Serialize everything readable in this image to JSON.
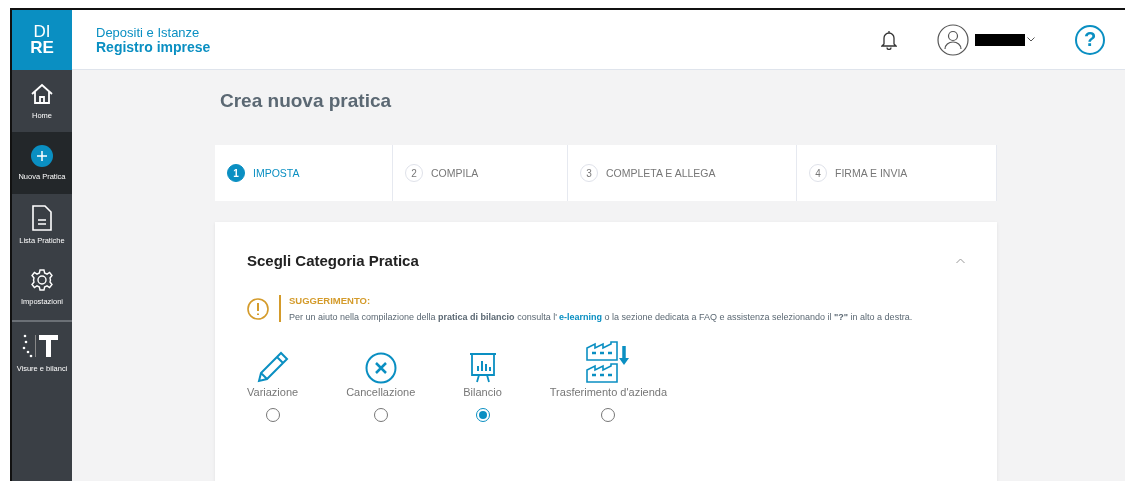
{
  "header": {
    "logo_top": "DI",
    "logo_bottom": "RE",
    "subtitle": "Depositi e Istanze",
    "title": "Registro imprese",
    "help": "?"
  },
  "sidebar": {
    "items": [
      {
        "label": "Home",
        "selected": false
      },
      {
        "label": "Nuova Pratica",
        "selected": true
      },
      {
        "label": "Lista Pratiche",
        "selected": false
      },
      {
        "label": "Impostazioni",
        "selected": false
      },
      {
        "label": "Visure e bilanci",
        "selected": false
      }
    ]
  },
  "page_title": "Crea nuova pratica",
  "steps": [
    {
      "number": "1",
      "label": "IMPOSTA",
      "selected": true
    },
    {
      "number": "2",
      "label": "COMPILA",
      "selected": false
    },
    {
      "number": "3",
      "label": "COMPLETA E ALLEGA",
      "selected": false
    },
    {
      "number": "4",
      "label": "FIRMA E INVIA",
      "selected": false
    }
  ],
  "card": {
    "title": "Scegli Categoria Pratica",
    "expanded": true,
    "hint": {
      "title": "SUGGERIMENTO:",
      "text_before": "Per un aiuto nella compilazione della **pratica di bilancio** consulta l'",
      "link": "e-learning",
      "text_after": " o la sezione dedicata a FAQ e assistenza selezionando il **\"?\"** in alto a destra."
    },
    "options": [
      {
        "label": "Variazione",
        "selected": false
      },
      {
        "label": "Cancellazione",
        "selected": false
      },
      {
        "label": "Bilancio",
        "selected": true
      },
      {
        "label": "Trasferimento d'azienda",
        "selected": false
      }
    ]
  }
}
